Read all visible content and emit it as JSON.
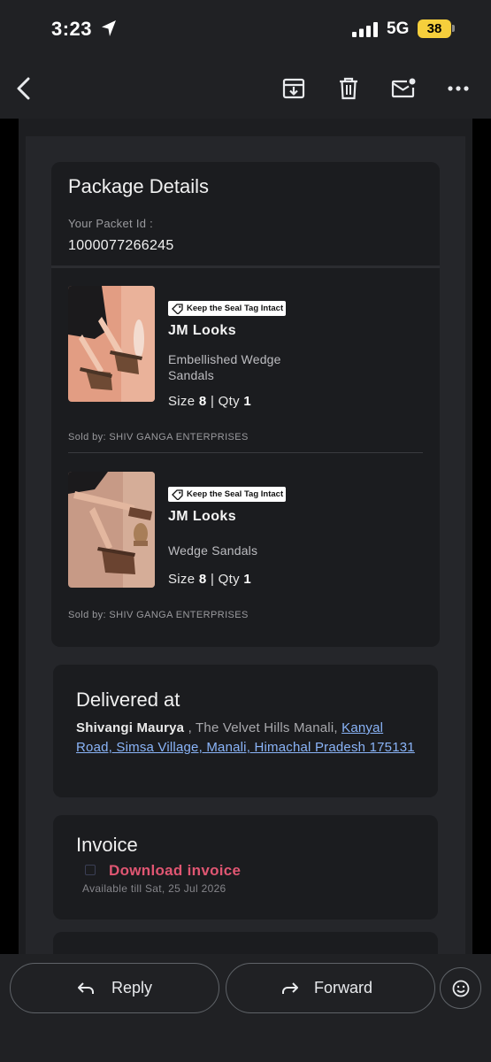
{
  "status_bar": {
    "time": "3:23",
    "network": "5G",
    "battery": "38"
  },
  "toolbar": {
    "icons": [
      "back-arrow-icon",
      "archive-icon",
      "delete-icon",
      "mark-unread-icon",
      "more-icon"
    ]
  },
  "package": {
    "title": "Package Details",
    "packet_label": "Your Packet Id :",
    "packet_id": "1000077266245",
    "items": [
      {
        "seal_tag": "Keep the Seal Tag Intact",
        "brand": "JM Looks",
        "product": "Embellished Wedge Sandals",
        "size_label": "Size",
        "size": "8",
        "separator": "|",
        "qty_label": "Qty",
        "qty": "1",
        "sold_by": "Sold by: SHIV GANGA ENTERPRISES"
      },
      {
        "seal_tag": "Keep the Seal Tag Intact",
        "brand": "JM Looks",
        "product": "Wedge Sandals",
        "size_label": "Size",
        "size": "8",
        "separator": "|",
        "qty_label": "Qty",
        "qty": "1",
        "sold_by": "Sold by: SHIV GANGA ENTERPRISES"
      }
    ]
  },
  "delivery": {
    "title": "Delivered at",
    "name": "Shivangi Maurya",
    "address_plain": " , The Velvet Hills Manali, ",
    "address_link": "Kanyal Road, Simsa Village, Manali, Himachal Pradesh 175131"
  },
  "invoice": {
    "title": "Invoice",
    "download_label": "Download invoice",
    "available": "Available till Sat, 25 Jul 2026"
  },
  "actions": {
    "reply": "Reply",
    "forward": "Forward"
  },
  "colors": {
    "accent_link": "#8ab4f8",
    "download_link": "#e05672",
    "battery": "#f6cf3c"
  }
}
